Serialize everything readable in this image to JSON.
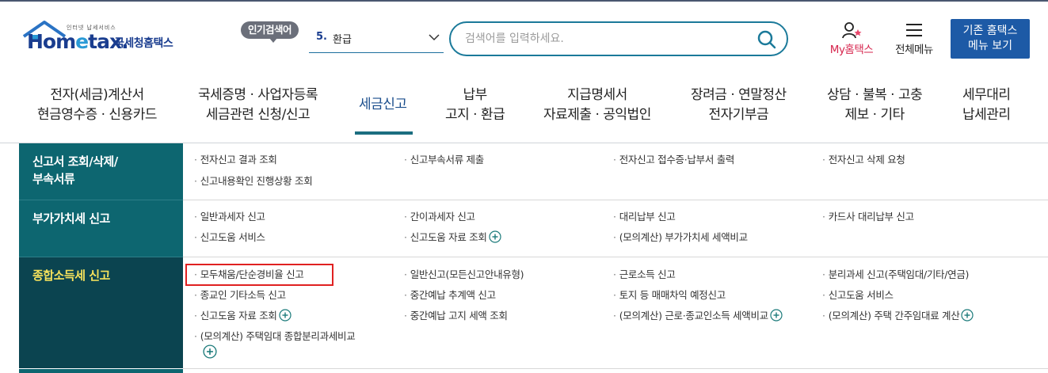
{
  "header": {
    "logo_small": "인터넷 납세서비스",
    "logo_text_a": "Hom",
    "logo_text_b": "e",
    "logo_text_c": "tax.",
    "logo_korean": "국세청홈택스",
    "popular_label": "인기검색어",
    "popular_rank": "5.",
    "popular_keyword": "환급",
    "search_placeholder": "검색어를 입력하세요.",
    "my_hometax": "My홈택스",
    "all_menu": "전체메뉴",
    "legacy_line1": "기존 홈택스",
    "legacy_line2": "메뉴 보기"
  },
  "gnb": [
    {
      "line1": "전자(세금)계산서",
      "line2": "현금영수증 · 신용카드"
    },
    {
      "line1": "국세증명 · 사업자등록",
      "line2": "세금관련 신청/신고"
    },
    {
      "line1": "세금신고",
      "line2": ""
    },
    {
      "line1": "납부",
      "line2": "고지 · 환급"
    },
    {
      "line1": "지급명세서",
      "line2": "자료제출 · 공익법인"
    },
    {
      "line1": "장려금 · 연말정산",
      "line2": "전자기부금"
    },
    {
      "line1": "상담 · 불복 · 고충",
      "line2": "제보 · 기타"
    },
    {
      "line1": "세무대리",
      "line2": "납세관리"
    }
  ],
  "sections": [
    {
      "category_line1": "신고서 조회/삭제/",
      "category_line2": "부속서류",
      "links": [
        "전자신고 결과 조회",
        "신고부속서류 제출",
        "전자신고 접수증·납부서 출력",
        "전자신고 삭제 요청",
        "신고내용확인 진행상황 조회"
      ]
    },
    {
      "category_line1": "부가가치세 신고",
      "links": [
        "일반과세자 신고",
        "간이과세자 신고",
        "대리납부 신고",
        "카드사 대리납부 신고",
        "신고도움 서비스",
        "신고도움 자료 조회",
        "(모의계산) 부가가치세 세액비교"
      ]
    },
    {
      "category_line1": "종합소득세 신고",
      "links": [
        "모두채움/단순경비율 신고",
        "일반신고(모든신고안내유형)",
        "근로소득 신고",
        "분리과세 신고(주택임대/기타/연금)",
        "종교인 기타소득 신고",
        "중간예납 추계액 신고",
        "토지 등 매매차익 예정신고",
        "신고도움 서비스",
        "신고도움 자료 조회",
        "중간예납 고지 세액 조회",
        "(모의계산) 근로·종교인소득 세액비교",
        "(모의계산) 주택 간주임대료 계산",
        "(모의계산) 주택임대 종합분리과세비교"
      ]
    }
  ],
  "colors": {
    "brand_navy": "#1a3d8f",
    "teal": "#0d6670",
    "teal_dark": "#0b4450",
    "active_yellow": "#f7e25c",
    "highlight_red": "#e02121",
    "legacy_btn": "#1d5aa6"
  }
}
